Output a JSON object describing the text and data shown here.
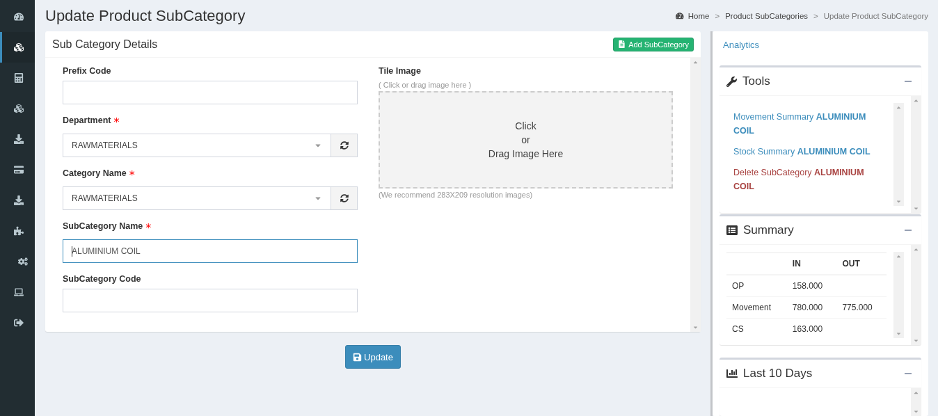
{
  "sidebar": {
    "items": [
      {
        "selected": false
      },
      {
        "selected": true
      },
      {
        "selected": false
      },
      {
        "selected": false
      },
      {
        "selected": false
      },
      {
        "selected": false
      },
      {
        "selected": false
      },
      {
        "selected": false
      },
      {
        "selected": false
      },
      {
        "selected": false
      },
      {
        "selected": false
      }
    ]
  },
  "page_title": "Update Product SubCategory",
  "breadcrumb": {
    "separator": ">",
    "items": [
      {
        "label": "Home",
        "kind": "home"
      },
      {
        "label": "Product SubCategories",
        "kind": "link"
      },
      {
        "label": "Update Product SubCategory",
        "kind": "current"
      }
    ]
  },
  "card": {
    "title": "Sub Category Details",
    "add_button": "Add SubCategory",
    "required_mark": "*",
    "fields": [
      {
        "label": "Prefix Code",
        "kind": "text",
        "required": false,
        "focused": false
      },
      {
        "label": "Department",
        "kind": "select",
        "required": true,
        "value": "RAWMATERIALS",
        "focused": false
      },
      {
        "label": "Category Name",
        "kind": "select",
        "required": true,
        "value": "RAWMATERIALS",
        "focused": false
      },
      {
        "label": "SubCategory Name",
        "kind": "text",
        "required": true,
        "value": "ALUMINIUM COIL",
        "focused": true
      },
      {
        "label": "SubCategory Code",
        "kind": "text",
        "required": false,
        "focused": false
      }
    ],
    "tile_image": {
      "label": "Tile Image",
      "hint": "( Click or drag image here )",
      "drop_lines": [
        "Click",
        "or",
        "Drag Image Here"
      ],
      "note": "(We recommend 283X209 resolution images)"
    }
  },
  "update_button": "Update",
  "analytics": {
    "title": "Analytics",
    "tools": {
      "title": "Tools",
      "links": [
        {
          "text": "Movement Summary **ALUMINIUM COIL**",
          "kind": "normal"
        },
        {
          "text": "Stock Summary **ALUMINIUM COIL**",
          "kind": "normal"
        },
        {
          "text": "Delete SubCategory **ALUMINIUM COIL**",
          "kind": "danger"
        }
      ]
    },
    "summary": {
      "title": "Summary",
      "columns": [
        null,
        "IN",
        "OUT"
      ],
      "rows": [
        [
          "OP",
          "158.000",
          null
        ],
        [
          "Movement",
          "780.000",
          "775.000"
        ],
        [
          "CS",
          "163.000",
          null
        ]
      ]
    },
    "last_days": {
      "title": "Last 10 Days"
    }
  }
}
